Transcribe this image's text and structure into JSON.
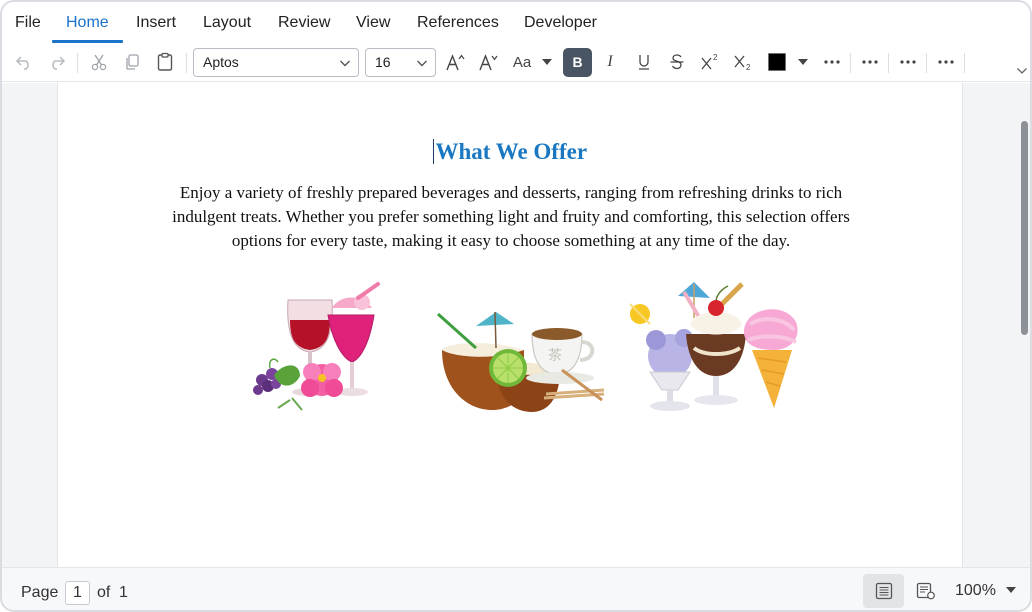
{
  "menu": {
    "items": [
      {
        "id": "file",
        "label": "File"
      },
      {
        "id": "home",
        "label": "Home"
      },
      {
        "id": "insert",
        "label": "Insert"
      },
      {
        "id": "layout",
        "label": "Layout"
      },
      {
        "id": "review",
        "label": "Review"
      },
      {
        "id": "view",
        "label": "View"
      },
      {
        "id": "references",
        "label": "References"
      },
      {
        "id": "developer",
        "label": "Developer"
      }
    ],
    "active": "Home"
  },
  "toolbar": {
    "font_family": "Aptos",
    "font_size": "16",
    "change_case_label": "Aa",
    "bold_label": "B",
    "italic_label": "I",
    "font_color": "#000000",
    "icons": [
      "undo-icon",
      "redo-icon",
      "cut-icon",
      "copy-icon",
      "paste-icon",
      "grow-font-icon",
      "shrink-font-icon",
      "underline-icon",
      "strikethrough-icon",
      "superscript-icon",
      "subscript-icon",
      "more-icon"
    ]
  },
  "document": {
    "heading": "What We Offer",
    "paragraph": "Enjoy a variety of freshly prepared beverages and desserts, ranging from refreshing drinks to rich indulgent treats. Whether you prefer something light and fruity and comforting, this selection offers options for every taste, making it easy to choose something at any time of the day.",
    "heading_color": "#1a78c2"
  },
  "status": {
    "page_label": "Page",
    "page_number": "1",
    "of_label": "of",
    "page_total": "1",
    "zoom": "100%"
  },
  "colors": {
    "accent": "#1a73c8",
    "bold_active_bg": "#4a5563"
  }
}
